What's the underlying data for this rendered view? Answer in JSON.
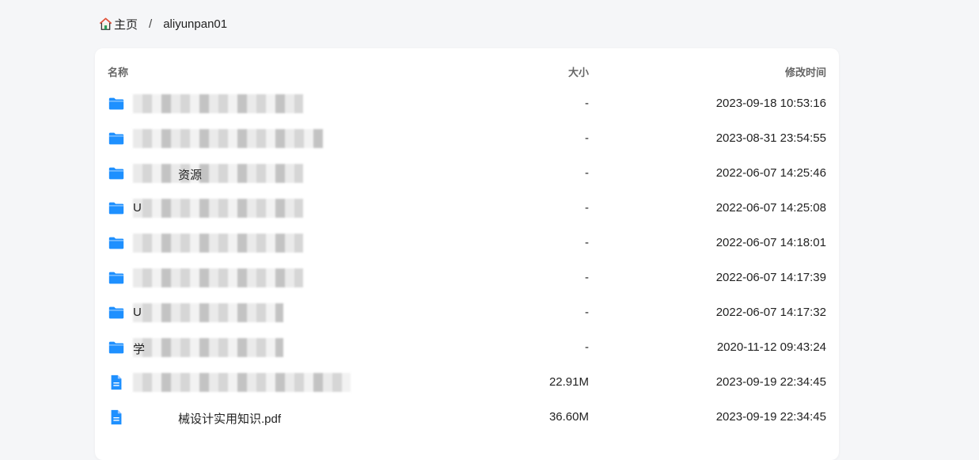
{
  "breadcrumb": {
    "home": "主页",
    "separator": "/",
    "current": "aliyunpan01"
  },
  "table": {
    "headers": {
      "name": "名称",
      "size": "大小",
      "time": "修改时间"
    },
    "rows": [
      {
        "type": "folder",
        "name": "",
        "size": "-",
        "time": "2023-09-18 10:53:16"
      },
      {
        "type": "folder",
        "name": "",
        "size": "-",
        "time": "2023-08-31 23:54:55"
      },
      {
        "type": "folder",
        "name": "资源",
        "size": "-",
        "time": "2022-06-07 14:25:46"
      },
      {
        "type": "folder",
        "name": "U",
        "size": "-",
        "time": "2022-06-07 14:25:08"
      },
      {
        "type": "folder",
        "name": "",
        "size": "-",
        "time": "2022-06-07 14:18:01"
      },
      {
        "type": "folder",
        "name": "",
        "size": "-",
        "time": "2022-06-07 14:17:39"
      },
      {
        "type": "folder",
        "name": "U",
        "size": "-",
        "time": "2022-06-07 14:17:32"
      },
      {
        "type": "folder",
        "name": "学",
        "size": "-",
        "time": "2020-11-12 09:43:24"
      },
      {
        "type": "file",
        "name": "",
        "size": "22.91M",
        "time": "2023-09-19 22:34:45"
      },
      {
        "type": "file",
        "name": "械设计实用知识.pdf",
        "size": "36.60M",
        "time": "2023-09-19 22:34:45"
      }
    ]
  },
  "colors": {
    "folder": "#1e90ff",
    "page_bg": "#f5f6f8"
  },
  "icons": {
    "home": "home-icon",
    "folder": "folder-icon",
    "file": "file-icon"
  }
}
